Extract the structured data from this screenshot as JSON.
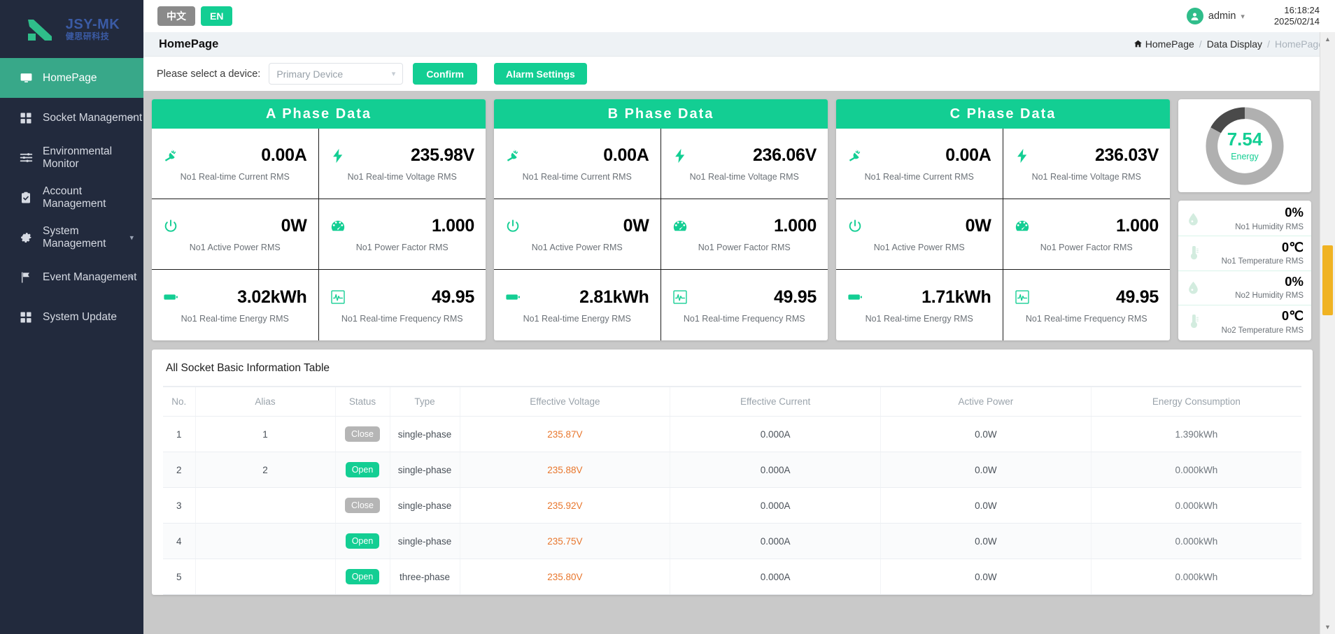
{
  "brand": {
    "name": "JSY-MK",
    "sub": "健思研科技",
    "logo_color": "#2fbd8a",
    "text_color": "#3b5ba5"
  },
  "theme": {
    "accent": "#13ce93",
    "sidebar_bg": "#222a3d",
    "active_nav": "#38a889",
    "voltage_orange": "#e8762c",
    "scrollbar_thumb": "#f0b323"
  },
  "topbar": {
    "lang_cn": "中文",
    "lang_en": "EN",
    "user": "admin",
    "time": "16:18:24",
    "date": "2025/02/14"
  },
  "pagebar": {
    "title": "HomePage",
    "breadcrumb": {
      "root": "HomePage",
      "middle": "Data Display",
      "current": "HomePage",
      "sep": "/"
    }
  },
  "toolbar": {
    "select_label": "Please select a device:",
    "device_value": "Primary Device",
    "confirm_label": "Confirm",
    "alarm_label": "Alarm Settings"
  },
  "sidebar": {
    "items": [
      {
        "label": "HomePage",
        "icon": "monitor-icon",
        "active": true,
        "caret": false
      },
      {
        "label": "Socket Management",
        "icon": "grid-icon",
        "active": false,
        "caret": true
      },
      {
        "label": "Environmental Monitor",
        "icon": "sliders-icon",
        "active": false,
        "caret": false
      },
      {
        "label": "Account Management",
        "icon": "clipboard-check-icon",
        "active": false,
        "caret": false
      },
      {
        "label": "System Management",
        "icon": "gear-icon",
        "active": false,
        "caret": true
      },
      {
        "label": "Event Management",
        "icon": "flag-icon",
        "active": false,
        "caret": true
      },
      {
        "label": "System Update",
        "icon": "grid-icon",
        "active": false,
        "caret": false
      }
    ]
  },
  "phases": [
    {
      "title": "A Phase Data",
      "metrics": [
        {
          "icon": "plug-icon",
          "value": "0.00A",
          "label": "No1 Real-time Current RMS"
        },
        {
          "icon": "bolt-icon",
          "value": "235.98V",
          "label": "No1 Real-time Voltage RMS"
        },
        {
          "icon": "power-icon",
          "value": "0W",
          "label": "No1 Active Power RMS"
        },
        {
          "icon": "gauge-icon",
          "value": "1.000",
          "label": "No1 Power Factor RMS"
        },
        {
          "icon": "battery-icon",
          "value": "3.02kWh",
          "label": "No1 Real-time Energy RMS"
        },
        {
          "icon": "waveform-icon",
          "value": "49.95",
          "label": "No1 Real-time Frequency RMS"
        }
      ]
    },
    {
      "title": "B Phase Data",
      "metrics": [
        {
          "icon": "plug-icon",
          "value": "0.00A",
          "label": "No1 Real-time Current RMS"
        },
        {
          "icon": "bolt-icon",
          "value": "236.06V",
          "label": "No1 Real-time Voltage RMS"
        },
        {
          "icon": "power-icon",
          "value": "0W",
          "label": "No1 Active Power RMS"
        },
        {
          "icon": "gauge-icon",
          "value": "1.000",
          "label": "No1 Power Factor RMS"
        },
        {
          "icon": "battery-icon",
          "value": "2.81kWh",
          "label": "No1 Real-time Energy RMS"
        },
        {
          "icon": "waveform-icon",
          "value": "49.95",
          "label": "No1 Real-time Frequency RMS"
        }
      ]
    },
    {
      "title": "C Phase Data",
      "metrics": [
        {
          "icon": "plug-icon",
          "value": "0.00A",
          "label": "No1 Real-time Current RMS"
        },
        {
          "icon": "bolt-icon",
          "value": "236.03V",
          "label": "No1 Real-time Voltage RMS"
        },
        {
          "icon": "power-icon",
          "value": "0W",
          "label": "No1 Active Power RMS"
        },
        {
          "icon": "gauge-icon",
          "value": "1.000",
          "label": "No1 Power Factor RMS"
        },
        {
          "icon": "battery-icon",
          "value": "1.71kWh",
          "label": "No1 Real-time Energy RMS"
        },
        {
          "icon": "waveform-icon",
          "value": "49.95",
          "label": "No1 Real-time Frequency RMS"
        }
      ]
    }
  ],
  "gauge": {
    "value": "7.54",
    "caption": "Energy",
    "dark_fraction": 0.17,
    "track_color": "#b0b0b0",
    "fill_color": "#4a4a4a"
  },
  "environment": [
    {
      "icon": "humidity-icon",
      "value": "0%",
      "label": "No1 Humidity RMS"
    },
    {
      "icon": "temperature-icon",
      "value": "0℃",
      "label": "No1 Temperature RMS"
    },
    {
      "icon": "humidity-icon",
      "value": "0%",
      "label": "No2 Humidity RMS"
    },
    {
      "icon": "temperature-icon",
      "value": "0℃",
      "label": "No2 Temperature RMS"
    }
  ],
  "table": {
    "title": "All Socket Basic Information Table",
    "columns": [
      "No.",
      "Alias",
      "Status",
      "Type",
      "Effective Voltage",
      "Effective Current",
      "Active Power",
      "Energy Consumption"
    ],
    "rows": [
      {
        "no": "1",
        "alias": "1",
        "status": "Close",
        "status_state": "close",
        "type": "single-phase",
        "voltage": "235.87V",
        "current": "0.000A",
        "power": "0.0W",
        "energy": "1.390kWh"
      },
      {
        "no": "2",
        "alias": "2",
        "status": "Open",
        "status_state": "open",
        "type": "single-phase",
        "voltage": "235.88V",
        "current": "0.000A",
        "power": "0.0W",
        "energy": "0.000kWh"
      },
      {
        "no": "3",
        "alias": "",
        "status": "Close",
        "status_state": "close",
        "type": "single-phase",
        "voltage": "235.92V",
        "current": "0.000A",
        "power": "0.0W",
        "energy": "0.000kWh"
      },
      {
        "no": "4",
        "alias": "",
        "status": "Open",
        "status_state": "open",
        "type": "single-phase",
        "voltage": "235.75V",
        "current": "0.000A",
        "power": "0.0W",
        "energy": "0.000kWh"
      },
      {
        "no": "5",
        "alias": "",
        "status": "Open",
        "status_state": "open",
        "type": "three-phase",
        "voltage": "235.80V",
        "current": "0.000A",
        "power": "0.0W",
        "energy": "0.000kWh"
      }
    ]
  }
}
